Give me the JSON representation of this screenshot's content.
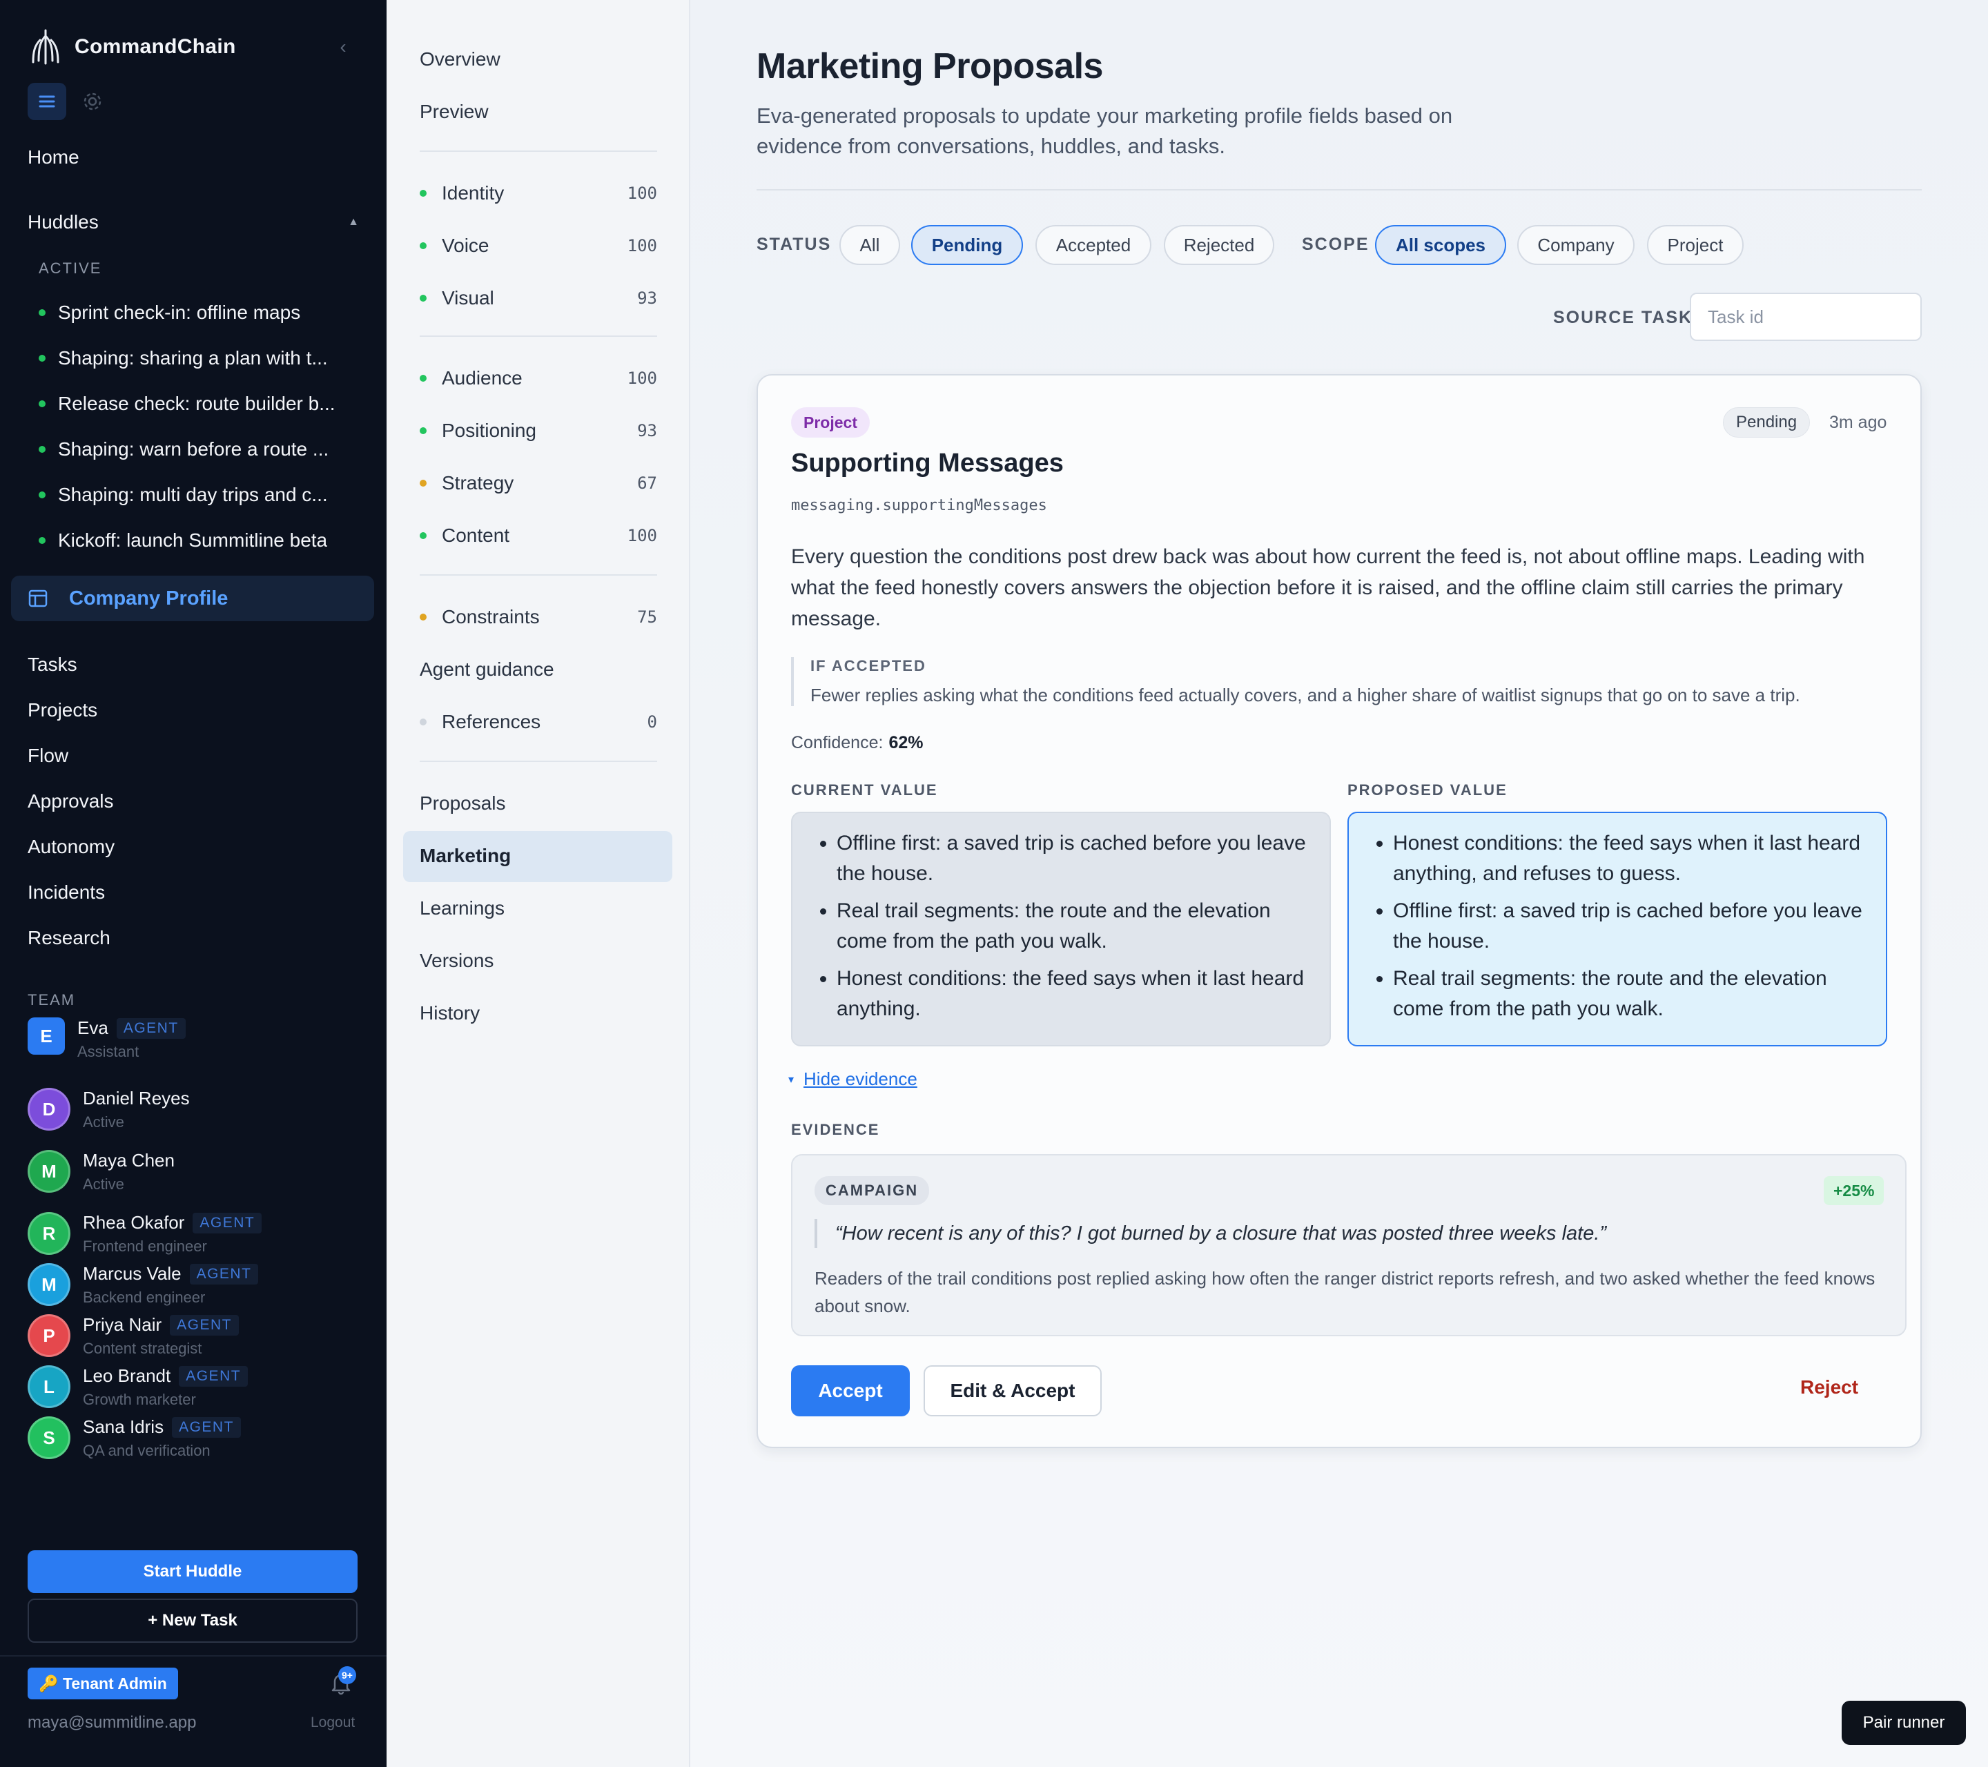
{
  "app": {
    "name": "CommandChain"
  },
  "sidebar": {
    "home": "Home",
    "huddles_label": "Huddles",
    "active_label": "ACTIVE",
    "huddles": [
      "Sprint check-in: offline maps",
      "Shaping: sharing a plan with t...",
      "Release check: route builder b...",
      "Shaping: warn before a route ...",
      "Shaping: multi day trips and c...",
      "Kickoff: launch Summitline beta"
    ],
    "company_profile": "Company Profile",
    "nav": [
      "Tasks",
      "Projects",
      "Flow",
      "Approvals",
      "Autonomy",
      "Incidents",
      "Research"
    ],
    "team_label": "TEAM",
    "agent_tag": "AGENT",
    "team": [
      {
        "initial": "E",
        "name": "Eva",
        "role": "Assistant",
        "agent": true,
        "color": "#2b7bf2"
      },
      {
        "initial": "D",
        "name": "Daniel Reyes",
        "role": "Active",
        "agent": false,
        "color": "#7c4ddb"
      },
      {
        "initial": "M",
        "name": "Maya Chen",
        "role": "Active",
        "agent": false,
        "color": "#1fa84f"
      },
      {
        "initial": "R",
        "name": "Rhea Okafor",
        "role": "Frontend engineer",
        "agent": true,
        "color": "#22b55a"
      },
      {
        "initial": "M",
        "name": "Marcus Vale",
        "role": "Backend engineer",
        "agent": true,
        "color": "#1aa0dd"
      },
      {
        "initial": "P",
        "name": "Priya Nair",
        "role": "Content strategist",
        "agent": true,
        "color": "#e5484d"
      },
      {
        "initial": "L",
        "name": "Leo Brandt",
        "role": "Growth marketer",
        "agent": true,
        "color": "#17a5c4"
      },
      {
        "initial": "S",
        "name": "Sana Idris",
        "role": "QA and verification",
        "agent": true,
        "color": "#22c05f"
      }
    ],
    "start_huddle": "Start Huddle",
    "new_task": "+ New Task",
    "tenant_admin": "🔑 Tenant Admin",
    "notif_count": "9+",
    "user_email": "maya@summitline.app",
    "logout": "Logout"
  },
  "subnav": {
    "overview": "Overview",
    "preview": "Preview",
    "groups": [
      [
        {
          "label": "Identity",
          "value": "100",
          "color": "#22c55e"
        },
        {
          "label": "Voice",
          "value": "100",
          "color": "#22c55e"
        },
        {
          "label": "Visual",
          "value": "93",
          "color": "#22c55e"
        }
      ],
      [
        {
          "label": "Audience",
          "value": "100",
          "color": "#22c55e"
        },
        {
          "label": "Positioning",
          "value": "93",
          "color": "#22c55e"
        },
        {
          "label": "Strategy",
          "value": "67",
          "color": "#e0a422"
        },
        {
          "label": "Content",
          "value": "100",
          "color": "#22c55e"
        }
      ],
      [
        {
          "label": "Constraints",
          "value": "75",
          "color": "#e0a422"
        }
      ]
    ],
    "agent_guidance": "Agent guidance",
    "references": {
      "label": "References",
      "value": "0",
      "color": "#cfd5dd"
    },
    "links": [
      "Proposals",
      "Marketing",
      "Learnings",
      "Versions",
      "History"
    ],
    "selected": "Marketing"
  },
  "main": {
    "title": "Marketing Proposals",
    "subtitle": "Eva-generated proposals to update your marketing profile fields based on evidence from conversations, huddles, and tasks.",
    "status_label": "STATUS",
    "status_options": [
      "All",
      "Pending",
      "Accepted",
      "Rejected"
    ],
    "status_selected": "Pending",
    "scope_label": "SCOPE",
    "scope_options": [
      "All scopes",
      "Company",
      "Project"
    ],
    "scope_selected": "All scopes",
    "source_task_label": "SOURCE TASK",
    "source_task_placeholder": "Task id",
    "source_task_value": ""
  },
  "proposal": {
    "scope": "Project",
    "status": "Pending",
    "time_ago": "3m ago",
    "title": "Supporting Messages",
    "field_path": "messaging.supportingMessages",
    "rationale": "Every question the conditions post drew back was about how current the feed is, not about offline maps. Leading with what the feed honestly covers answers the objection before it is raised, and the offline claim still carries the primary message.",
    "if_accepted_label": "IF ACCEPTED",
    "if_accepted": "Fewer replies asking what the conditions feed actually covers, and a higher share of waitlist signups that go on to save a trip.",
    "confidence_label": "Confidence:",
    "confidence": "62%",
    "current_label": "CURRENT VALUE",
    "current": [
      "Offline first: a saved trip is cached before you leave the house.",
      "Real trail segments: the route and the elevation come from the path you walk.",
      "Honest conditions: the feed says when it last heard anything."
    ],
    "proposed_label": "PROPOSED VALUE",
    "proposed": [
      "Honest conditions: the feed says when it last heard anything, and refuses to guess.",
      "Offline first: a saved trip is cached before you leave the house.",
      "Real trail segments: the route and the elevation come from the path you walk."
    ],
    "hide_evidence": "Hide evidence",
    "evidence_label": "EVIDENCE",
    "evidence": {
      "type": "CAMPAIGN",
      "delta": "+25%",
      "quote": "“How recent is any of this? I got burned by a closure that was posted three weeks late.”",
      "note": "Readers of the trail conditions post replied asking how often the ranger district reports refresh, and two asked whether the feed knows about snow."
    },
    "accept": "Accept",
    "edit_accept": "Edit & Accept",
    "reject": "Reject"
  },
  "pair_runner": "Pair runner"
}
